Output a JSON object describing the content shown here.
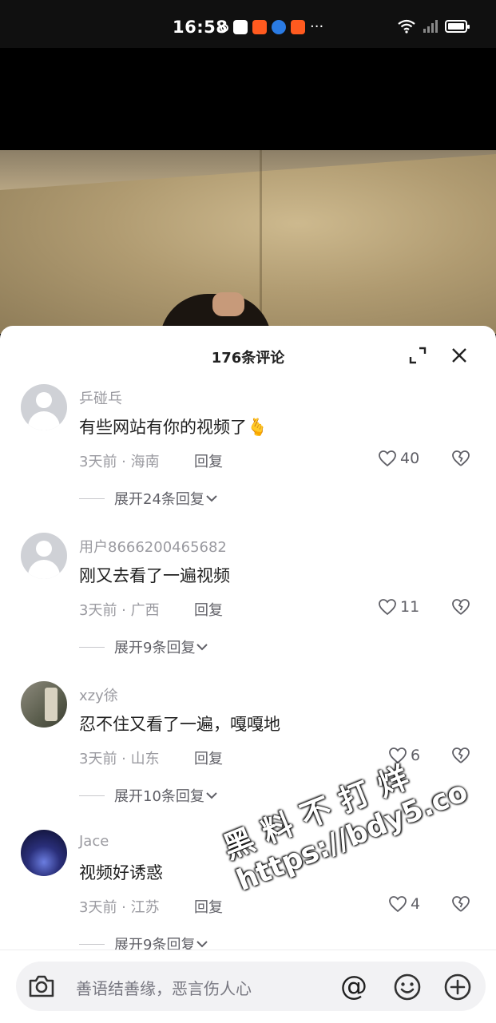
{
  "status_bar": {
    "time": "16:58",
    "more": "···"
  },
  "sheet": {
    "title": "176条评论"
  },
  "comments": [
    {
      "username": "乒碰乓",
      "text": "有些网站有你的视频了🫰",
      "time": "3天前",
      "location": "海南",
      "reply_label": "回复",
      "likes": "40",
      "expand_label": "展开24条回复"
    },
    {
      "username": "用户8666200465682",
      "text": "刚又去看了一遍视频",
      "time": "3天前",
      "location": "广西",
      "reply_label": "回复",
      "likes": "11",
      "expand_label": "展开9条回复"
    },
    {
      "username": "xzy徐",
      "text": "忍不住又看了一遍，嘎嘎地",
      "time": "3天前",
      "location": "山东",
      "reply_label": "回复",
      "likes": "6",
      "expand_label": "展开10条回复"
    },
    {
      "username": "Jace",
      "text": "视频好诱惑",
      "time": "3天前",
      "location": "江苏",
      "reply_label": "回复",
      "likes": "4",
      "expand_label": "展开9条回复"
    }
  ],
  "input": {
    "placeholder": "善语结善缘，恶言伤人心",
    "at_symbol": "@"
  },
  "watermark": {
    "line1": "黑料不打烊",
    "line2": "https://bdy5.co"
  },
  "colors": {
    "muted": "#9a9aa0",
    "text": "#1f1f1f",
    "sheet_bg": "#ffffff"
  }
}
